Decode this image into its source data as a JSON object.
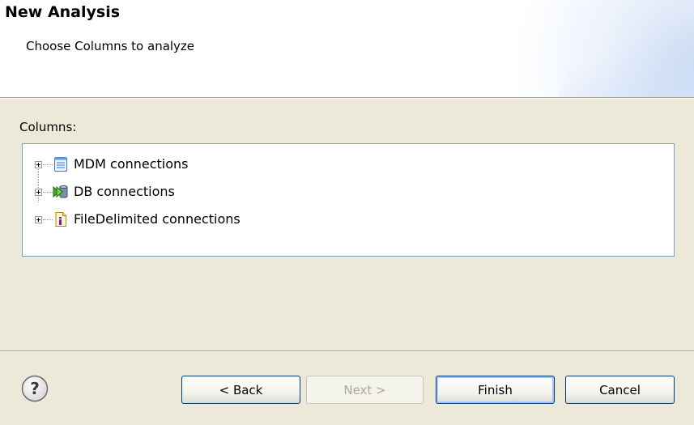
{
  "wizard": {
    "title": "New Analysis",
    "subtitle": "Choose Columns to analyze"
  },
  "columns": {
    "label": "Columns:",
    "tree": [
      {
        "label": "MDM connections",
        "icon": "mdm-connection-icon",
        "expanded": false
      },
      {
        "label": "DB connections",
        "icon": "db-connection-icon",
        "expanded": false
      },
      {
        "label": "FileDelimited connections",
        "icon": "file-delimited-icon",
        "expanded": false
      }
    ]
  },
  "buttons": {
    "help_icon": "help-icon",
    "back": "< Back",
    "next": "Next >",
    "finish": "Finish",
    "cancel": "Cancel"
  },
  "colors": {
    "dialog_bg": "#ece9d8",
    "tree_border": "#7f9db9",
    "button_border": "#003c74"
  }
}
